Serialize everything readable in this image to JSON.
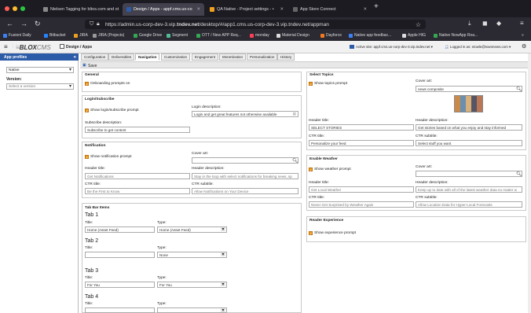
{
  "browser": {
    "tabs": [
      {
        "label": "Nielsen Tagging for bltos.com and ot",
        "color": "#888"
      },
      {
        "label": "Design / Apps - appf.cms.us-co",
        "color": "#2c5ca8"
      },
      {
        "label": "QA Native - Project settings - •",
        "color": "#f0a020"
      },
      {
        "label": "App Store Connect",
        "color": "#666"
      }
    ],
    "url_prefix": "https://admin.us-corp-dev-3.vip.",
    "url_bold": "tndev.net",
    "url_suffix": "/desktop/#/app1.cms.us-corp-dev-3.vip.tndev.net/appman",
    "bookmarks": [
      "Fusioni Daily",
      "Bitbucket",
      "JIRA",
      "JIRA (Projects)",
      "Google Drive",
      "Segment",
      "OTT / New APP Req...",
      "monday",
      "Material Design",
      "Dayforce",
      "Native app feedbac...",
      "Apple HIG",
      "Native NowApp Roa..."
    ]
  },
  "app": {
    "logo": "BLOX",
    "logo_suffix": "CMS",
    "breadcrumb": "Design / Apps",
    "active_site": "Active site: appf.cms.us-corp-dev-3.vip.tndev.net",
    "logged_in": "Logged in as: etowle@townnews.com"
  },
  "left": {
    "title": "App profiles",
    "profile": "Native",
    "version_label": "Version:",
    "version_placeholder": "Select a version"
  },
  "tabs": [
    "Configuration",
    "Deliverables",
    "Navigation",
    "Customization",
    "Engagement",
    "Monetization",
    "Personalization",
    "History"
  ],
  "save_label": "Save",
  "general": {
    "title": "General",
    "onboarding": "Onboarding prompts on"
  },
  "login": {
    "title": "Login/Subscribe",
    "show": "Show login/subscribe prompt",
    "login_desc_label": "Login description:",
    "login_desc": "Login and get great features not otherwise available",
    "sub_desc_label": "Subscribe description:",
    "sub_desc": "Subscribe to get content"
  },
  "notification": {
    "title": "Notification",
    "show": "Show notification prompt",
    "cover_label": "Cover art:",
    "header_title_label": "Header title:",
    "header_title": "Get Notifications",
    "header_desc_label": "Header description:",
    "header_desc": "Stay in the loop with select notifications for breaking news, sp",
    "ctr_title_label": "CTR title:",
    "ctr_title": "Be the First to Know",
    "ctr_sub_label": "CTR subtitle:",
    "ctr_sub": "Allow Notifications on Your Device"
  },
  "tabbar": {
    "title": "Tab Bar Items",
    "title_label": "Title:",
    "type_label": "Type:",
    "items": [
      {
        "name": "Tab 1",
        "title": "Home (Asset Feed)",
        "type": "Home (Asset Feed)"
      },
      {
        "name": "Tab 2",
        "title": "",
        "type": "None"
      },
      {
        "name": "Tab 3",
        "title": "For You",
        "type": "For You"
      },
      {
        "name": "Tab 4",
        "title": "",
        "type": ""
      }
    ]
  },
  "topics": {
    "title": "Select Topics",
    "show": "Show topics prompt",
    "cover_label": "Cover art:",
    "cover": "news composite",
    "header_title_label": "Header title:",
    "header_title": "SELECT STORIES",
    "header_desc_label": "Header description:",
    "header_desc": "Get stories based on what you enjoy and stay informed",
    "ctr_title_label": "CTR title:",
    "ctr_title": "Personalize your feed",
    "ctr_sub_label": "CTR subtitle:",
    "ctr_sub": "Select stuff you want"
  },
  "weather": {
    "title": "Enable Weather",
    "show": "Show weather prompt",
    "cover_label": "Cover art:",
    "header_title_label": "Header title:",
    "header_title": "Get Local Weather",
    "header_desc_label": "Header description:",
    "header_desc": "Keep up to date with all of the latest weather data no matter w",
    "ctr_title_label": "CTR title:",
    "ctr_title": "Never Get Surprised by Weather Again",
    "ctr_sub_label": "CTR subtitle:",
    "ctr_sub": "Allow Location Data for Hyper-Local Forecasts"
  },
  "reader": {
    "title": "Reader Experience",
    "show": "Show experience prompt"
  },
  "colors": {
    "accent": "#2c5ca8",
    "check": "#f0a020"
  }
}
